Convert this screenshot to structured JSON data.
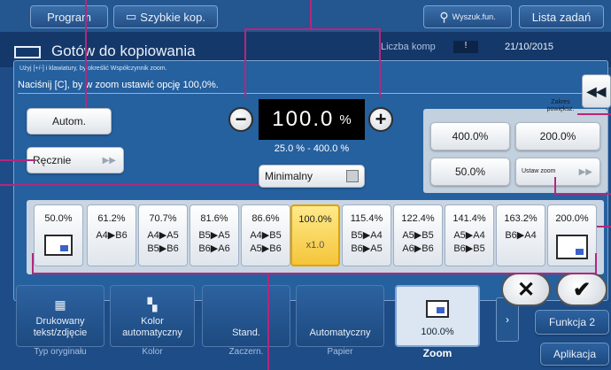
{
  "topbar": {
    "program": "Program",
    "quick_copy": "Szybkie kop.",
    "search": "Wyszuk.fun.",
    "job_list": "Lista zadań"
  },
  "status": {
    "title": "Gotów do kopiowania",
    "copy_count_label": "Liczba komp",
    "date": "21/10/2015"
  },
  "dialog": {
    "hint": "Użyj [+/-] i klawiatury, by określić Współczynnik zoom.",
    "instruction": "Naciśnij [C], by w zoom ustawić opcję 100,0%.",
    "auto_label": "Autom.",
    "manual_label": "Ręcznie",
    "zoom_value": "100.0",
    "zoom_unit": "%",
    "range": "25.0 % - 400.0 %",
    "minimal_label": "Minimalny",
    "zoom_range_title": "Zakres powiększ.",
    "set_zoom_label": "Ustaw zoom"
  },
  "zoom_buttons": [
    "400.0%",
    "200.0%",
    "50.0%"
  ],
  "presets": [
    {
      "pct": "50.0%",
      "line1": "",
      "line2": ""
    },
    {
      "pct": "61.2%",
      "line1": "A4▶B6",
      "line2": ""
    },
    {
      "pct": "70.7%",
      "line1": "A4▶A5",
      "line2": "B5▶B6"
    },
    {
      "pct": "81.6%",
      "line1": "B5▶A5",
      "line2": "B6▶A6"
    },
    {
      "pct": "86.6%",
      "line1": "A4▶B5",
      "line2": "A5▶B6"
    },
    {
      "pct": "100.0%",
      "line1": "",
      "line2": "x1.0"
    },
    {
      "pct": "115.4%",
      "line1": "B5▶A4",
      "line2": "B6▶A5"
    },
    {
      "pct": "122.4%",
      "line1": "A5▶B5",
      "line2": "A6▶B6"
    },
    {
      "pct": "141.4%",
      "line1": "A5▶A4",
      "line2": "B6▶B5"
    },
    {
      "pct": "163.2%",
      "line1": "B6▶A4",
      "line2": ""
    },
    {
      "pct": "200.0%",
      "line1": "",
      "line2": ""
    }
  ],
  "bottom": {
    "tabs": [
      {
        "text": "Drukowany tekst/zdjęcie",
        "label": "Typ oryginału"
      },
      {
        "text": "Kolor automatyczny",
        "label": "Kolor"
      },
      {
        "text": "Stand.",
        "label": "Zaczern."
      },
      {
        "text": "Automatyczny",
        "label": "Papier"
      },
      {
        "text": "100.0%",
        "label": "Zoom"
      }
    ],
    "function2": "Funkcja 2",
    "applications": "Aplikacja"
  },
  "colors": {
    "accent": "#b5267d",
    "selected": "#f4c53a",
    "background": "#1e4c86"
  }
}
